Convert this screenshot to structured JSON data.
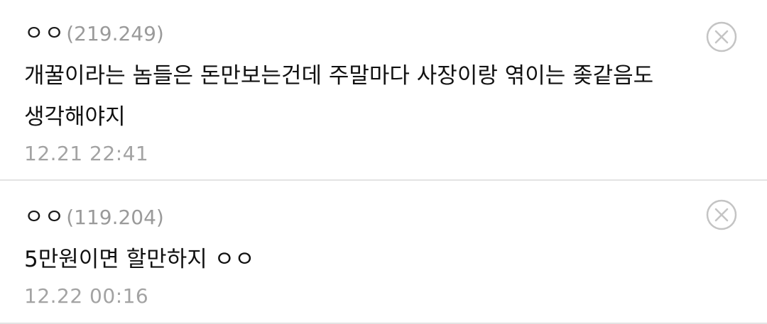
{
  "comments": [
    {
      "nickname": "ㅇㅇ",
      "ip": "(219.249)",
      "body": "개꿀이라는 놈들은 돈만보는건데 주말마다 사장이랑 엮이는 좆같음도 생각해야지",
      "timestamp": "12.21 22:41",
      "delete_icon": "close-circle-icon"
    },
    {
      "nickname": "ㅇㅇ",
      "ip": "(119.204)",
      "body": "5만원이면 할만하지 ㅇㅇ",
      "timestamp": "12.22 00:16",
      "delete_icon": "close-circle-icon"
    }
  ],
  "colors": {
    "text": "#111111",
    "meta": "#9a9a9a",
    "divider": "#e3e3e3",
    "icon": "#c4c4c4"
  }
}
